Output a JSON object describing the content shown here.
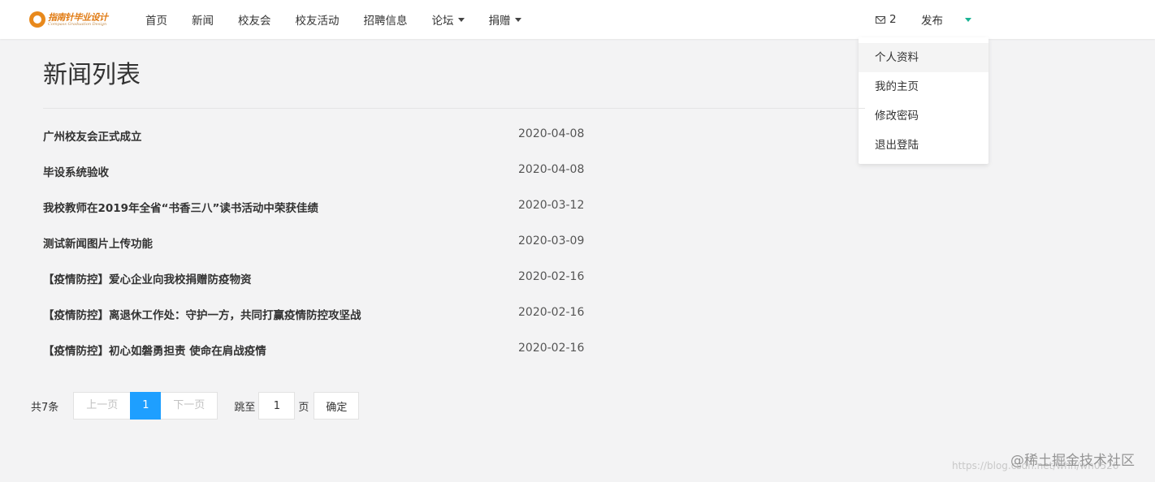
{
  "header": {
    "logo": {
      "title": "指南针毕业设计",
      "subtitle": "Compass Graduation Design"
    },
    "nav": [
      {
        "label": "首页",
        "has_caret": false
      },
      {
        "label": "新闻",
        "has_caret": false
      },
      {
        "label": "校友会",
        "has_caret": false
      },
      {
        "label": "校友活动",
        "has_caret": false
      },
      {
        "label": "招聘信息",
        "has_caret": false
      },
      {
        "label": "论坛",
        "has_caret": true
      },
      {
        "label": "捐赠",
        "has_caret": true
      }
    ],
    "mail_count": "2",
    "publish_label": "发布"
  },
  "user_menu": {
    "items": [
      "个人资料",
      "我的主页",
      "修改密码",
      "退出登陆"
    ],
    "highlighted_index": 0
  },
  "main": {
    "title": "新闻列表",
    "news": [
      {
        "title": "广州校友会正式成立",
        "date": "2020-04-08"
      },
      {
        "title": "毕设系统验收",
        "date": "2020-04-08"
      },
      {
        "title": "我校教师在2019年全省“书香三八”读书活动中荣获佳绩",
        "date": "2020-03-12"
      },
      {
        "title": "测试新闻图片上传功能",
        "date": "2020-03-09"
      },
      {
        "title": "【疫情防控】爱心企业向我校捐赠防疫物资",
        "date": "2020-02-16"
      },
      {
        "title": "【疫情防控】离退休工作处：守护一方，共同打赢疫情防控攻坚战",
        "date": "2020-02-16"
      },
      {
        "title": "【疫情防控】初心如磐勇担责 使命在肩战疫情",
        "date": "2020-02-16"
      }
    ]
  },
  "pagination": {
    "total": "共7条",
    "prev": "上一页",
    "current": "1",
    "next": "下一页",
    "jump_label": "跳至",
    "jump_value": "1",
    "page_unit": "页",
    "confirm": "确定"
  },
  "watermark": {
    "url": "https://blog.csdn.net/whh/wh0526",
    "brand": "@稀土掘金技术社区"
  },
  "colors": {
    "accent": "#1e9fff",
    "user_caret": "#1ab394",
    "logo": "#e07a12",
    "background": "#f3f3f4"
  }
}
